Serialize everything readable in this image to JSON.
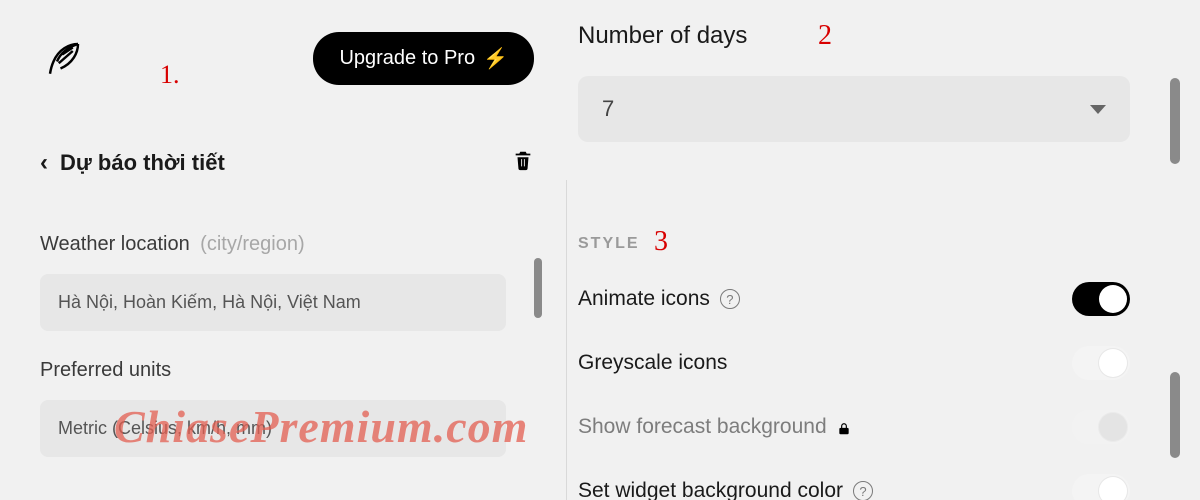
{
  "annotations": {
    "one": "1.",
    "two": "2",
    "three": "3"
  },
  "header": {
    "upgrade_label": "Upgrade to Pro"
  },
  "title_row": {
    "back_glyph": "‹",
    "title": "Dự báo thời tiết"
  },
  "location_field": {
    "label": "Weather location",
    "hint": "(city/region)",
    "value": "Hà Nội, Hoàn Kiếm, Hà Nội, Việt Nam"
  },
  "units_field": {
    "label": "Preferred units",
    "value": "Metric (Celsius, km/h, mm)"
  },
  "days_field": {
    "label": "Number of days",
    "value": "7"
  },
  "style_section": {
    "heading": "STYLE",
    "rows": [
      {
        "label": "Animate icons",
        "help": true,
        "lock": false,
        "on": true,
        "disabled": false
      },
      {
        "label": "Greyscale icons",
        "help": false,
        "lock": false,
        "on": false,
        "disabled": false
      },
      {
        "label": "Show forecast background",
        "help": false,
        "lock": true,
        "on": false,
        "disabled": true
      },
      {
        "label": "Set widget background color",
        "help": true,
        "lock": false,
        "on": false,
        "disabled": false
      }
    ]
  },
  "watermark": "ChiasePremium.com",
  "icons": {
    "help_glyph": "?"
  }
}
